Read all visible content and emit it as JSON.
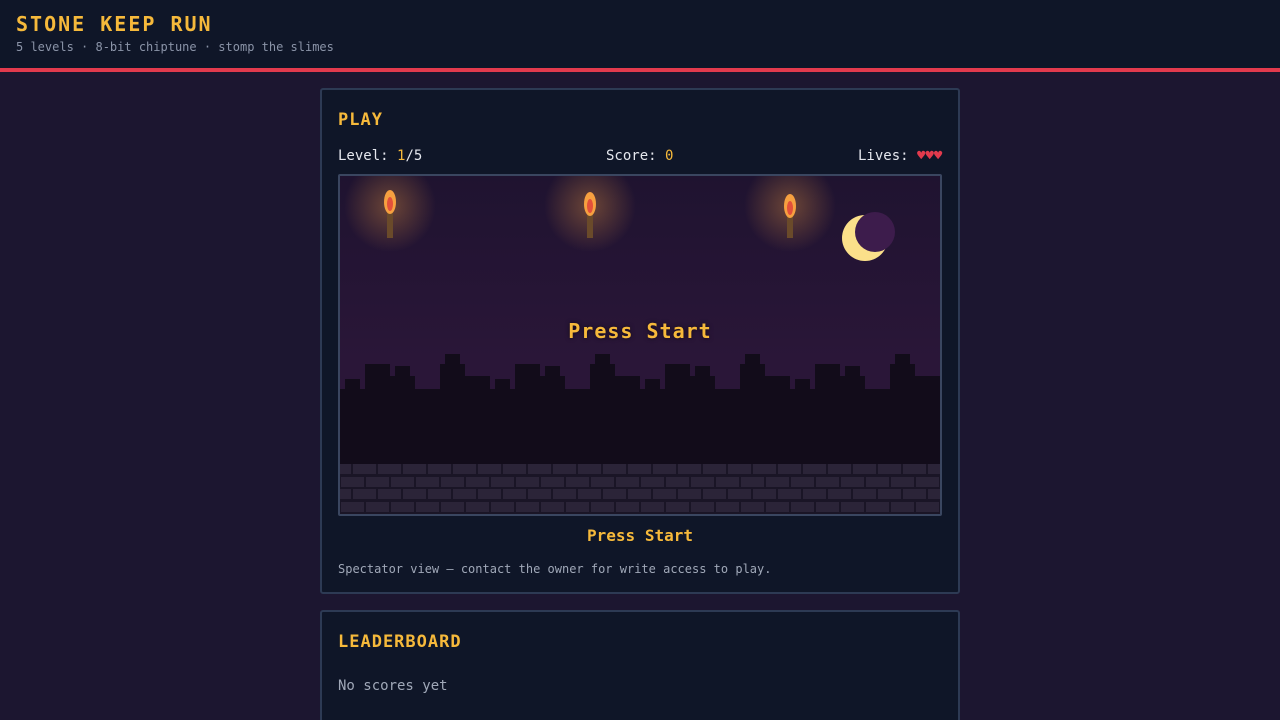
{
  "header": {
    "title": "STONE KEEP RUN",
    "subtitle": "5 levels · 8-bit chiptune · stomp the slimes"
  },
  "play": {
    "title": "PLAY",
    "level_label": "Level: ",
    "level_current": "1",
    "level_total": "/5",
    "score_label": "Score: ",
    "score_value": "0",
    "lives_label": "Lives: ",
    "lives_value": "♥♥♥",
    "stage_overlay_text": "Press Start",
    "press_start_label": "Press Start",
    "spectator_note": "Spectator view — contact the owner for write access to play."
  },
  "leaderboard": {
    "title": "LEADERBOARD",
    "empty_text": "No scores yet"
  },
  "colors": {
    "accent": "#f6b93b",
    "danger": "#e23a4d",
    "panel_bg": "#0f1628",
    "page_bg": "#1c1630"
  }
}
